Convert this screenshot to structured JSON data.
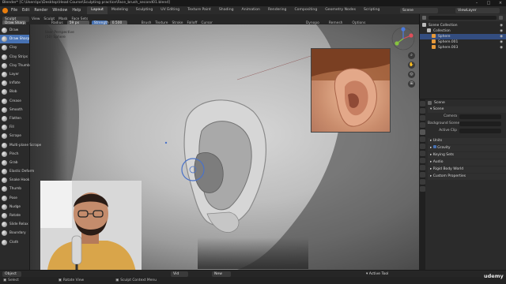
{
  "title_bar": {
    "text": "Blender* [C:\\Users\\pc\\Desktop\\Head Course\\Sculpting practice\\Face_brush_second01.blend]"
  },
  "menu": {
    "items": [
      "File",
      "Edit",
      "Render",
      "Window",
      "Help"
    ],
    "workspaces": [
      "Layout",
      "Modeling",
      "Sculpting",
      "UV Editing",
      "Texture Paint",
      "Shading",
      "Animation",
      "Rendering",
      "Compositing",
      "Geometry Nodes",
      "Scripting"
    ],
    "active_workspace": "Layout",
    "scene_label": "Scene",
    "view_layer_label": "ViewLayer"
  },
  "header": {
    "mode": "Sculpt Mode",
    "menus": [
      "View",
      "Sculpt",
      "Mask",
      "Face Sets"
    ],
    "brush_name": "Draw Sharp",
    "radius_label": "Radius",
    "radius_value": "59 px",
    "strength_label": "Strength",
    "strength_value": "0.500",
    "dropdowns": [
      "Brush",
      "Texture",
      "Stroke",
      "Falloff",
      "Cursor"
    ],
    "symmetry_label": "Dynopo",
    "remesh_label": "Remesh",
    "options_label": "Options"
  },
  "viewport": {
    "perspective_text": "User Perspective",
    "object_text": "(50) Sphere"
  },
  "tools": [
    {
      "label": "Draw",
      "active": false
    },
    {
      "label": "Draw Sharp",
      "active": true
    },
    {
      "label": "Clay",
      "active": false
    },
    {
      "label": "Clay Strips",
      "active": false
    },
    {
      "label": "Clay Thumb",
      "active": false
    },
    {
      "label": "Layer",
      "active": false
    },
    {
      "label": "Inflate",
      "active": false
    },
    {
      "label": "Blob",
      "active": false
    },
    {
      "label": "Crease",
      "active": false
    },
    {
      "label": "Smooth",
      "active": false
    },
    {
      "label": "Flatten",
      "active": false
    },
    {
      "label": "Fill",
      "active": false
    },
    {
      "label": "Scrape",
      "active": false
    },
    {
      "label": "Multi-plane Scrape",
      "active": false
    },
    {
      "label": "Pinch",
      "active": false
    },
    {
      "label": "Grab",
      "active": false
    },
    {
      "label": "Elastic Deform",
      "active": false
    },
    {
      "label": "Snake Hook",
      "active": false
    },
    {
      "label": "Thumb",
      "active": false
    },
    {
      "label": "Pose",
      "active": false
    },
    {
      "label": "Nudge",
      "active": false
    },
    {
      "label": "Rotate",
      "active": false
    },
    {
      "label": "Slide Relax",
      "active": false
    },
    {
      "label": "Boundary",
      "active": false
    },
    {
      "label": "Cloth",
      "active": false
    }
  ],
  "outliner": {
    "rows": [
      {
        "label": "Scene Collection",
        "indent": 0,
        "selected": false
      },
      {
        "label": "Collection",
        "indent": 1,
        "selected": false
      },
      {
        "label": "Sphere",
        "indent": 2,
        "selected": true
      },
      {
        "label": "Sphere.001",
        "indent": 2,
        "selected": false
      },
      {
        "label": "Sphere.003",
        "indent": 2,
        "selected": false
      }
    ]
  },
  "properties": {
    "header": "Scene",
    "sections": {
      "scene": "Scene",
      "units": "Units",
      "gravity": "Gravity",
      "keying_sets": "Keying Sets",
      "audio": "Audio",
      "rigid_body_world": "Rigid Body World",
      "custom_properties": "Custom Properties"
    },
    "fields": [
      {
        "label": "Camera",
        "value": ""
      },
      {
        "label": "Background Scene",
        "value": ""
      },
      {
        "label": "Active Clip",
        "value": ""
      }
    ]
  },
  "bottom": {
    "object_menu": "Object",
    "view_label": "Vid",
    "new_label": "New",
    "active_tool": "Active Tool"
  },
  "status": {
    "items": [
      "Select",
      "Rotate View",
      "Sculpt Context Menu"
    ]
  },
  "watermark": "udemy",
  "colors": {
    "accent_blue": "#4772b3",
    "selection_blue": "#334d80"
  }
}
